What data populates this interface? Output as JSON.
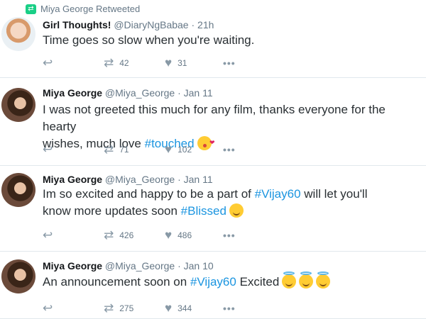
{
  "tweets": [
    {
      "retweeted_by": "Miya George Retweeted",
      "name": "Girl Thoughts!",
      "handle": "@DiaryNgBabae",
      "time": "· 21h",
      "text_parts": [
        "Time goes so slow when you're waiting."
      ],
      "retweets": "42",
      "likes": "31"
    },
    {
      "name": "Miya George",
      "handle": "@Miya_George",
      "time": "· Jan 11",
      "text_line1": "I was not greeted this much for any film, thanks everyone for the hearty",
      "text_line2_pre": "wishes, much love ",
      "hashtag": "#touched",
      "retweets": "71",
      "likes": "102"
    },
    {
      "name": "Miya George",
      "handle": "@Miya_George",
      "time": "· Jan 11",
      "text_pre": "Im so excited and happy to be a part of ",
      "hashtag1": "#Vijay60",
      "text_mid": " will let you'll know more updates soon ",
      "hashtag2": "#Blissed",
      "retweets": "426",
      "likes": "486"
    },
    {
      "name": "Miya George",
      "handle": "@Miya_George",
      "time": "· Jan 10",
      "text_pre": "An announcement soon on ",
      "hashtag": "#Vijay60",
      "text_post": " Excited",
      "retweets": "275",
      "likes": "344"
    }
  ],
  "icons": {
    "reply": "reply-icon",
    "retweet": "retweet-icon",
    "like": "heart-icon",
    "more": "more-icon"
  },
  "colors": {
    "hashtag": "#1b95e0",
    "retweet_badge": "#19cf86",
    "meta": "#657786"
  }
}
